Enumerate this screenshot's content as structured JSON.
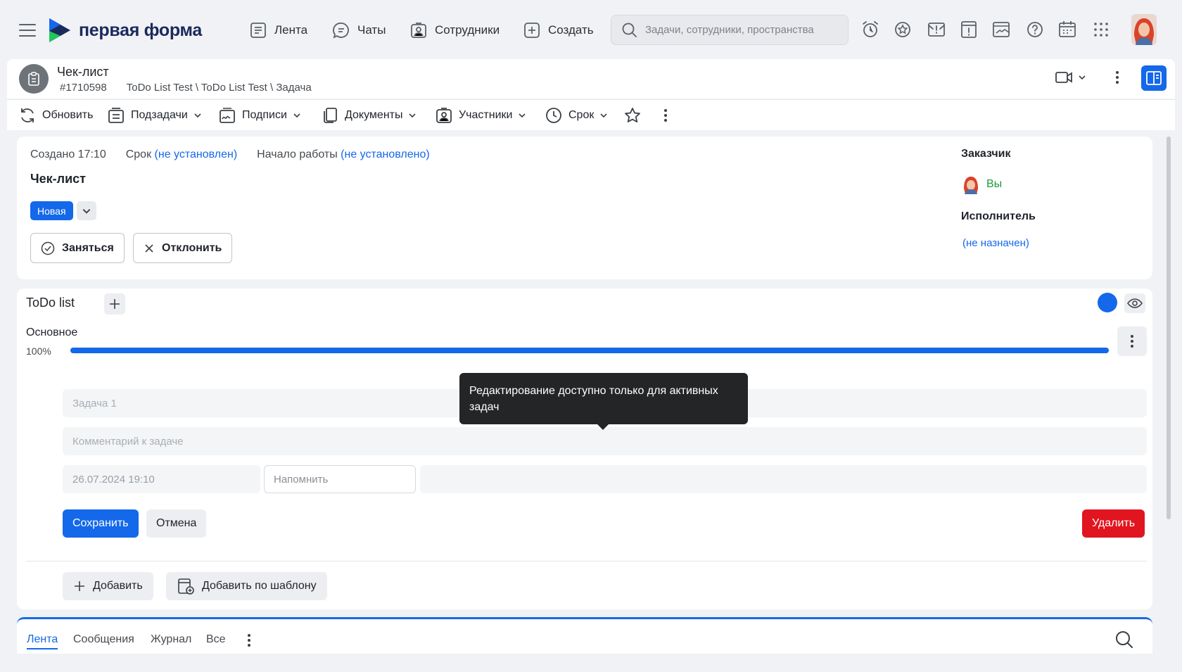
{
  "nav": {
    "logo_text": "первая форма",
    "items": [
      {
        "label": "Лента",
        "icon": "feed-icon"
      },
      {
        "label": "Чаты",
        "icon": "chat-icon"
      },
      {
        "label": "Сотрудники",
        "icon": "employees-icon"
      },
      {
        "label": "Создать",
        "icon": "plus-square-icon"
      }
    ],
    "search_placeholder": "Задачи, сотрудники, пространства",
    "icons": [
      "alarm-icon",
      "star-circle-icon",
      "mail-alert-icon",
      "document-alert-icon",
      "media-icon",
      "help-icon",
      "calendar-icon",
      "apps-grid-icon"
    ]
  },
  "task": {
    "type_title": "Чек-лист",
    "id": "#1710598",
    "breadcrumb": "ToDo List Test \\ ToDo List Test \\ Задача"
  },
  "toolbar": {
    "refresh": "Обновить",
    "subtasks": "Подзадачи",
    "signatures": "Подписи",
    "documents": "Документы",
    "participants": "Участники",
    "deadline": "Срок"
  },
  "info": {
    "created": "Создано 17:10",
    "deadline_label": "Срок",
    "deadline_value": "(не установлен)",
    "start_label": "Начало работы",
    "start_value": "(не установлено)",
    "title": "Чек-лист",
    "status": "Новая",
    "take_button": "Заняться",
    "reject_button": "Отклонить",
    "customer_label": "Заказчик",
    "customer_value": "Вы",
    "assignee_label": "Исполнитель",
    "assignee_value": "(не назначен)"
  },
  "todo": {
    "title": "ToDo list",
    "section": "Основное",
    "progress_percent": 100,
    "progress_label": "100%",
    "task_placeholder": "Задача 1",
    "comment_placeholder": "Комментарий к задаче",
    "date_value": "26.07.2024 19:10",
    "remind_placeholder": "Напомнить",
    "save": "Сохранить",
    "cancel": "Отмена",
    "delete": "Удалить",
    "add": "Добавить",
    "add_template": "Добавить по шаблону",
    "tooltip": "Редактирование доступно только для активных задач"
  },
  "bottom_tabs": [
    "Лента",
    "Сообщения",
    "Журнал",
    "Все"
  ],
  "colors": {
    "accent": "#1468ea",
    "danger": "#e1151f",
    "success": "#1a9b3b"
  }
}
